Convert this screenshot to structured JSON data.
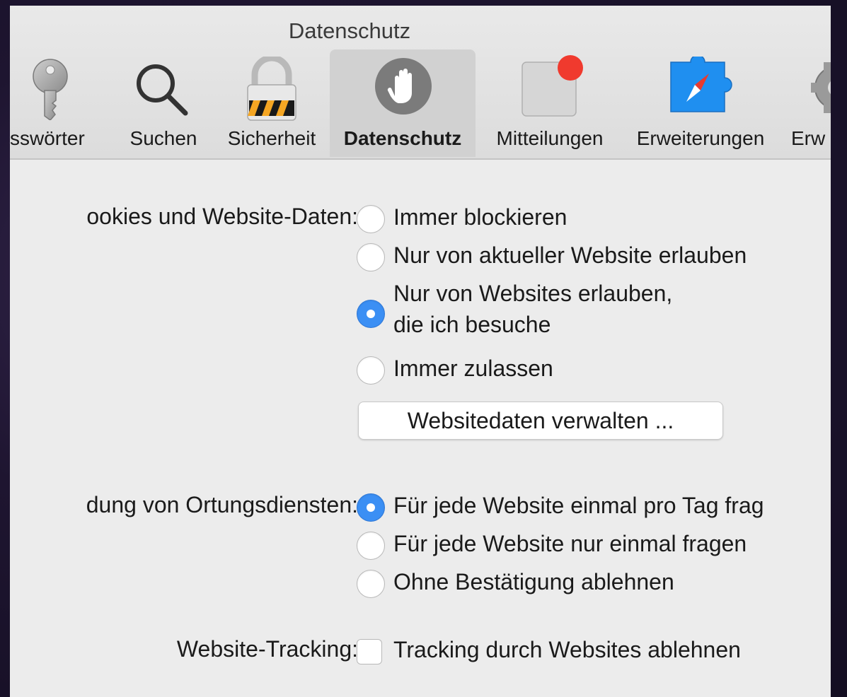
{
  "window": {
    "title": "Datenschutz"
  },
  "tabs": [
    {
      "label": "sswörter",
      "icon": "key-icon"
    },
    {
      "label": "Suchen",
      "icon": "search-icon"
    },
    {
      "label": "Sicherheit",
      "icon": "lock-icon"
    },
    {
      "label": "Datenschutz",
      "icon": "hand-icon",
      "selected": true
    },
    {
      "label": "Mitteilungen",
      "icon": "notifications-icon"
    },
    {
      "label": "Erweiterungen",
      "icon": "extensions-icon"
    },
    {
      "label": "Erw",
      "icon": "gear-icon"
    }
  ],
  "cookies": {
    "label": "ookies und Website-Daten:",
    "options": [
      {
        "label": "Immer blockieren",
        "selected": false
      },
      {
        "label": "Nur von aktueller Website erlauben",
        "selected": false
      },
      {
        "label_line1": "Nur von Websites erlauben,",
        "label_line2": "die ich besuche",
        "selected": true
      },
      {
        "label": "Immer zulassen",
        "selected": false
      }
    ],
    "manage_button": "Websitedaten verwalten ..."
  },
  "location": {
    "label": "dung von Ortungsdiensten:",
    "options": [
      {
        "label": "Für jede Website einmal pro Tag frag",
        "selected": true
      },
      {
        "label": "Für jede Website nur einmal fragen",
        "selected": false
      },
      {
        "label": "Ohne Bestätigung ablehnen",
        "selected": false
      }
    ]
  },
  "tracking": {
    "label": "Website-Tracking:",
    "checkbox_label": "Tracking durch Websites ablehnen",
    "checked": false
  },
  "colors": {
    "accent": "#3b8ff4",
    "window_bg": "#ececec",
    "notification_badge": "#f03a2e",
    "safari_blue": "#1f8ff0"
  }
}
